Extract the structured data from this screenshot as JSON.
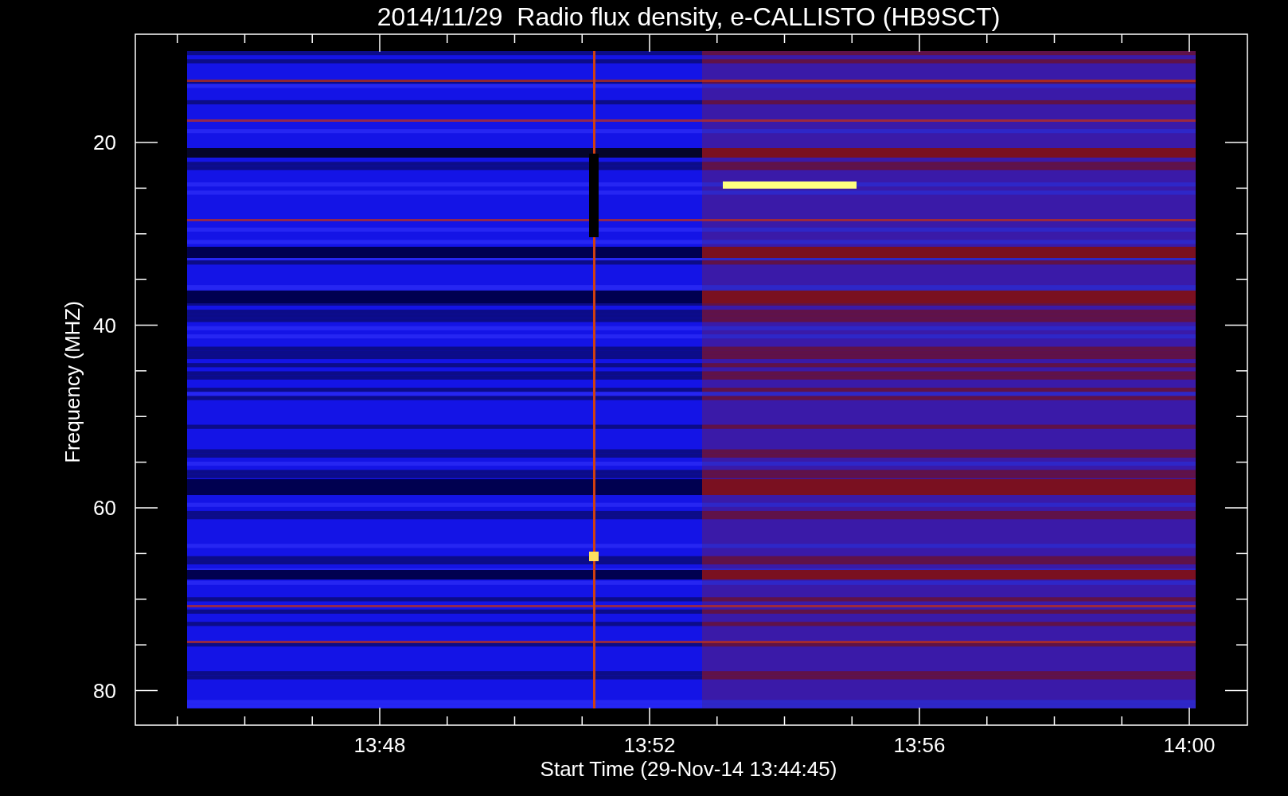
{
  "title": "2014/11/29  Radio flux density, e-CALLISTO (HB9SCT)",
  "y_axis": {
    "label": "Frequency (MHZ)",
    "ticks": [
      "20",
      "40",
      "60",
      "80"
    ]
  },
  "x_axis": {
    "label": "Start Time (29-Nov-14 13:44:45)",
    "ticks": [
      "13:48",
      "13:52",
      "13:56",
      "14:00"
    ]
  }
}
